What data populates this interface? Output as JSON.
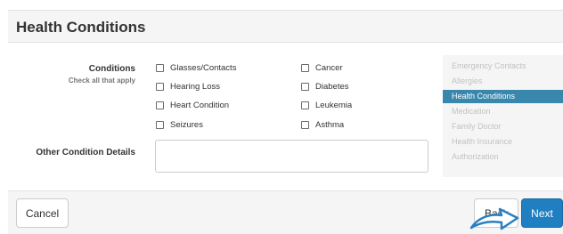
{
  "header": {
    "title": "Health Conditions"
  },
  "conditions": {
    "label": "Conditions",
    "sublabel": "Check all that apply",
    "left": [
      "Glasses/Contacts",
      "Hearing Loss",
      "Heart Condition",
      "Seizures"
    ],
    "right": [
      "Cancer",
      "Diabetes",
      "Leukemia",
      "Asthma"
    ]
  },
  "other": {
    "label": "Other Condition Details",
    "value": ""
  },
  "sidebar": {
    "items": [
      {
        "label": "Emergency Contacts",
        "active": false
      },
      {
        "label": "Allergies",
        "active": false
      },
      {
        "label": "Health Conditions",
        "active": true
      },
      {
        "label": "Medication",
        "active": false
      },
      {
        "label": "Family Doctor",
        "active": false
      },
      {
        "label": "Health Insurance",
        "active": false
      },
      {
        "label": "Authorization",
        "active": false
      }
    ]
  },
  "footer": {
    "cancel": "Cancel",
    "back": "Back",
    "next": "Next"
  },
  "colors": {
    "accent": "#3a87ad",
    "next_button": "#1f7fc1"
  },
  "icons": {
    "pointer": "curved-arrow-icon"
  }
}
